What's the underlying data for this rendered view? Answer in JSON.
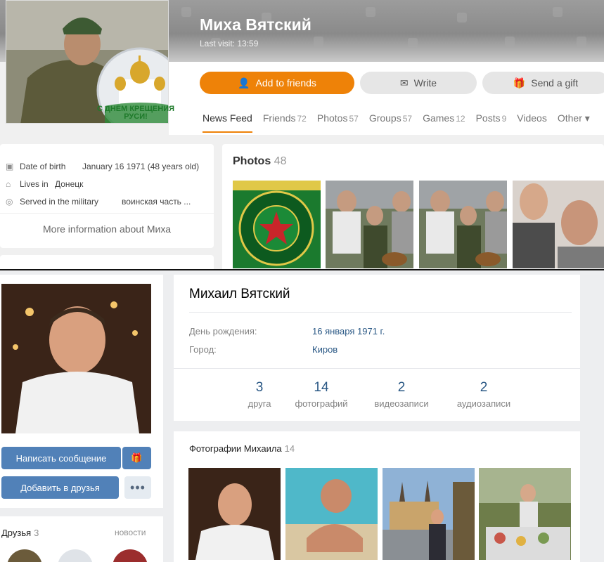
{
  "ok_profile": {
    "name": "Миха Вятский",
    "last_visit": "Last visit: 13:59",
    "avatar_caption": "С ДНЕМ КРЕЩЕНИЯ РУСИ!",
    "buttons": {
      "add_friends": "Add to friends",
      "write": "Write",
      "send_gift": "Send a gift"
    },
    "tabs": [
      {
        "label": "News Feed",
        "count": ""
      },
      {
        "label": "Friends",
        "count": "72"
      },
      {
        "label": "Photos",
        "count": "57"
      },
      {
        "label": "Groups",
        "count": "57"
      },
      {
        "label": "Games",
        "count": "12"
      },
      {
        "label": "Posts",
        "count": "9"
      },
      {
        "label": "Videos",
        "count": ""
      },
      {
        "label": "Other ▾",
        "count": ""
      }
    ],
    "info": {
      "dob_label": "Date of birth",
      "dob_value": "January 16 1971 (48 years old)",
      "lives_label": "Lives in",
      "lives_value": "Донецк",
      "military_label": "Served in the military",
      "military_value": "воинская часть ...",
      "more": "More information about Миха"
    },
    "photos": {
      "title": "Photos",
      "count": "48"
    },
    "colors": {
      "accent": "#ee8208"
    }
  },
  "vk_profile": {
    "name": "Михаил Вятский",
    "dob_label": "День рождения:",
    "dob_value": "16 января 1971 г.",
    "city_label": "Город:",
    "city_value": "Киров",
    "counters": [
      {
        "num": "3",
        "label": "друга"
      },
      {
        "num": "14",
        "label": "фотографий"
      },
      {
        "num": "2",
        "label": "видеозаписи"
      },
      {
        "num": "2",
        "label": "аудиозаписи"
      }
    ],
    "buttons": {
      "message": "Написать сообщение",
      "add_friend": "Добавить в друзья",
      "more": "•••"
    },
    "friends": {
      "title": "Друзья",
      "count": "3",
      "news": "новости"
    },
    "photos": {
      "title": "Фотографии Михаила",
      "count": "14"
    },
    "colors": {
      "accent": "#5181b8",
      "link": "#2a5885"
    }
  }
}
